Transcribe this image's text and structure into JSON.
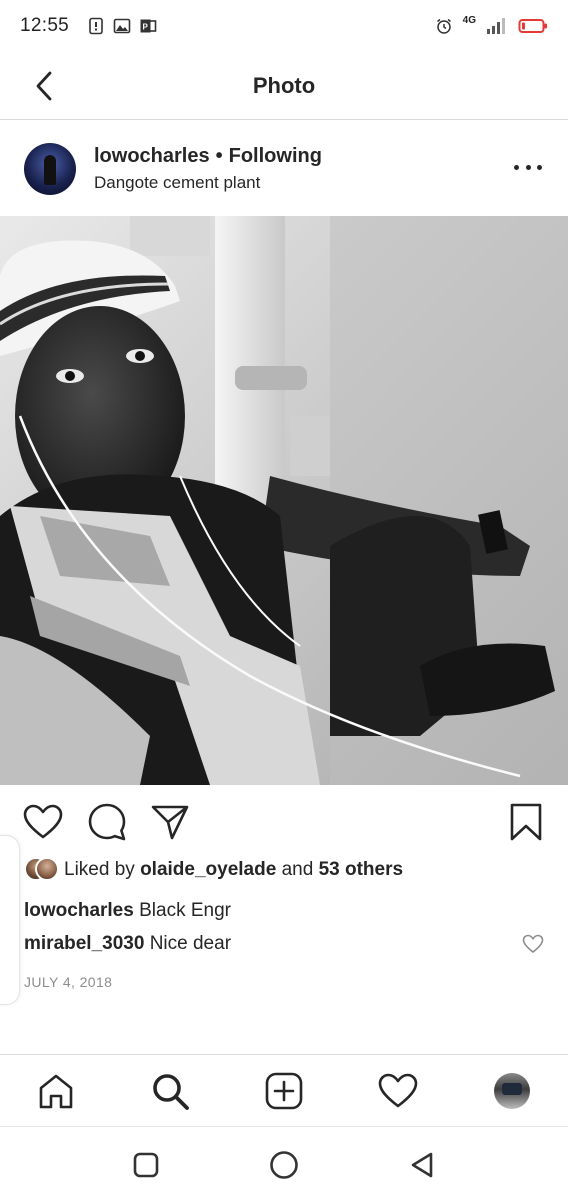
{
  "status_bar": {
    "time": "12:55",
    "network": "4G",
    "icons": [
      "notification-icon",
      "gallery-icon",
      "office-icon",
      "alarm-icon",
      "signal-icon",
      "battery-icon"
    ]
  },
  "header": {
    "title": "Photo",
    "back_icon": "chevron-left-icon"
  },
  "post": {
    "username": "lowocharles",
    "separator": "•",
    "follow_status": "Following",
    "location": "Dangote cement plant",
    "more_icon": "more-icon",
    "photo_icon": "photo-image",
    "actions": [
      "heart-icon",
      "comment-icon",
      "share-icon",
      "bookmark-icon"
    ],
    "likes": {
      "prefix": "Liked by",
      "liker": "olaide_oyelade",
      "conjunction": "and",
      "others": "53 others"
    },
    "caption": {
      "username": "lowocharles",
      "text": "Black Engr"
    },
    "comments": [
      {
        "username": "mirabel_3030",
        "text": "Nice dear"
      }
    ],
    "date": "JULY 4, 2018"
  },
  "bottom_nav": {
    "items": [
      "home-icon",
      "search-icon",
      "add-post-icon",
      "activity-icon",
      "profile-icon"
    ]
  },
  "system_nav": {
    "items": [
      "recents-icon",
      "home-circle-icon",
      "back-triangle-icon"
    ]
  },
  "colors": {
    "text": "#262626",
    "muted": "#8e8e8e",
    "divider": "#dbdbdb",
    "battery_red": "#e53935"
  }
}
